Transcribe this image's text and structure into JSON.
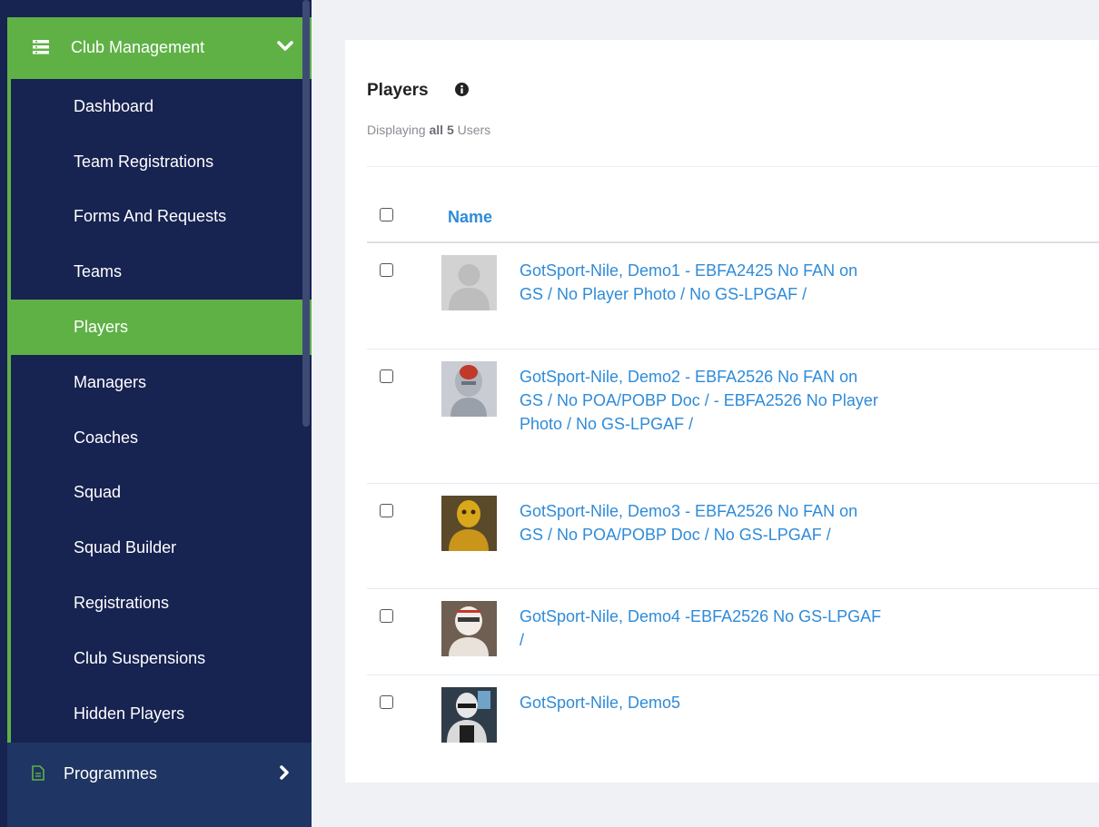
{
  "sidebar": {
    "section_title": "Club Management",
    "section_icon": "list-icon",
    "items": [
      {
        "label": "Dashboard",
        "active": false
      },
      {
        "label": "Team Registrations",
        "active": false
      },
      {
        "label": "Forms And Requests",
        "active": false
      },
      {
        "label": "Teams",
        "active": false
      },
      {
        "label": "Players",
        "active": true
      },
      {
        "label": "Managers",
        "active": false
      },
      {
        "label": "Coaches",
        "active": false
      },
      {
        "label": "Squad",
        "active": false
      },
      {
        "label": "Squad Builder",
        "active": false
      },
      {
        "label": "Registrations",
        "active": false
      },
      {
        "label": "Club Suspensions",
        "active": false
      },
      {
        "label": "Hidden Players",
        "active": false
      }
    ],
    "programmes_label": "Programmes",
    "colors": {
      "bg": "#172351",
      "accent": "#5fb146"
    }
  },
  "main": {
    "title": "Players",
    "displaying_prefix": "Displaying ",
    "displaying_count": "all 5",
    "displaying_suffix": " Users",
    "column_name": "Name",
    "players": [
      {
        "name": "GotSport-Nile, Demo1 - EBFA2425 No FAN on GS / No Player Photo / No GS-LPGAF /",
        "avatar": "default-silhouette"
      },
      {
        "name": "GotSport-Nile, Demo2 - EBFA2526 No FAN on GS / No POA/POBP Doc / - EBFA2526 No Player Photo / No GS-LPGAF /",
        "avatar": "robot-silver"
      },
      {
        "name": "GotSport-Nile, Demo3 - EBFA2526 No FAN on GS / No POA/POBP Doc / No GS-LPGAF /",
        "avatar": "robot-gold"
      },
      {
        "name": "GotSport-Nile, Demo4 -EBFA2526 No GS-LPGAF /",
        "avatar": "trooper-white"
      },
      {
        "name": "GotSport-Nile, Demo5",
        "avatar": "robot-dark"
      }
    ],
    "link_color": "#2f8bd8"
  }
}
